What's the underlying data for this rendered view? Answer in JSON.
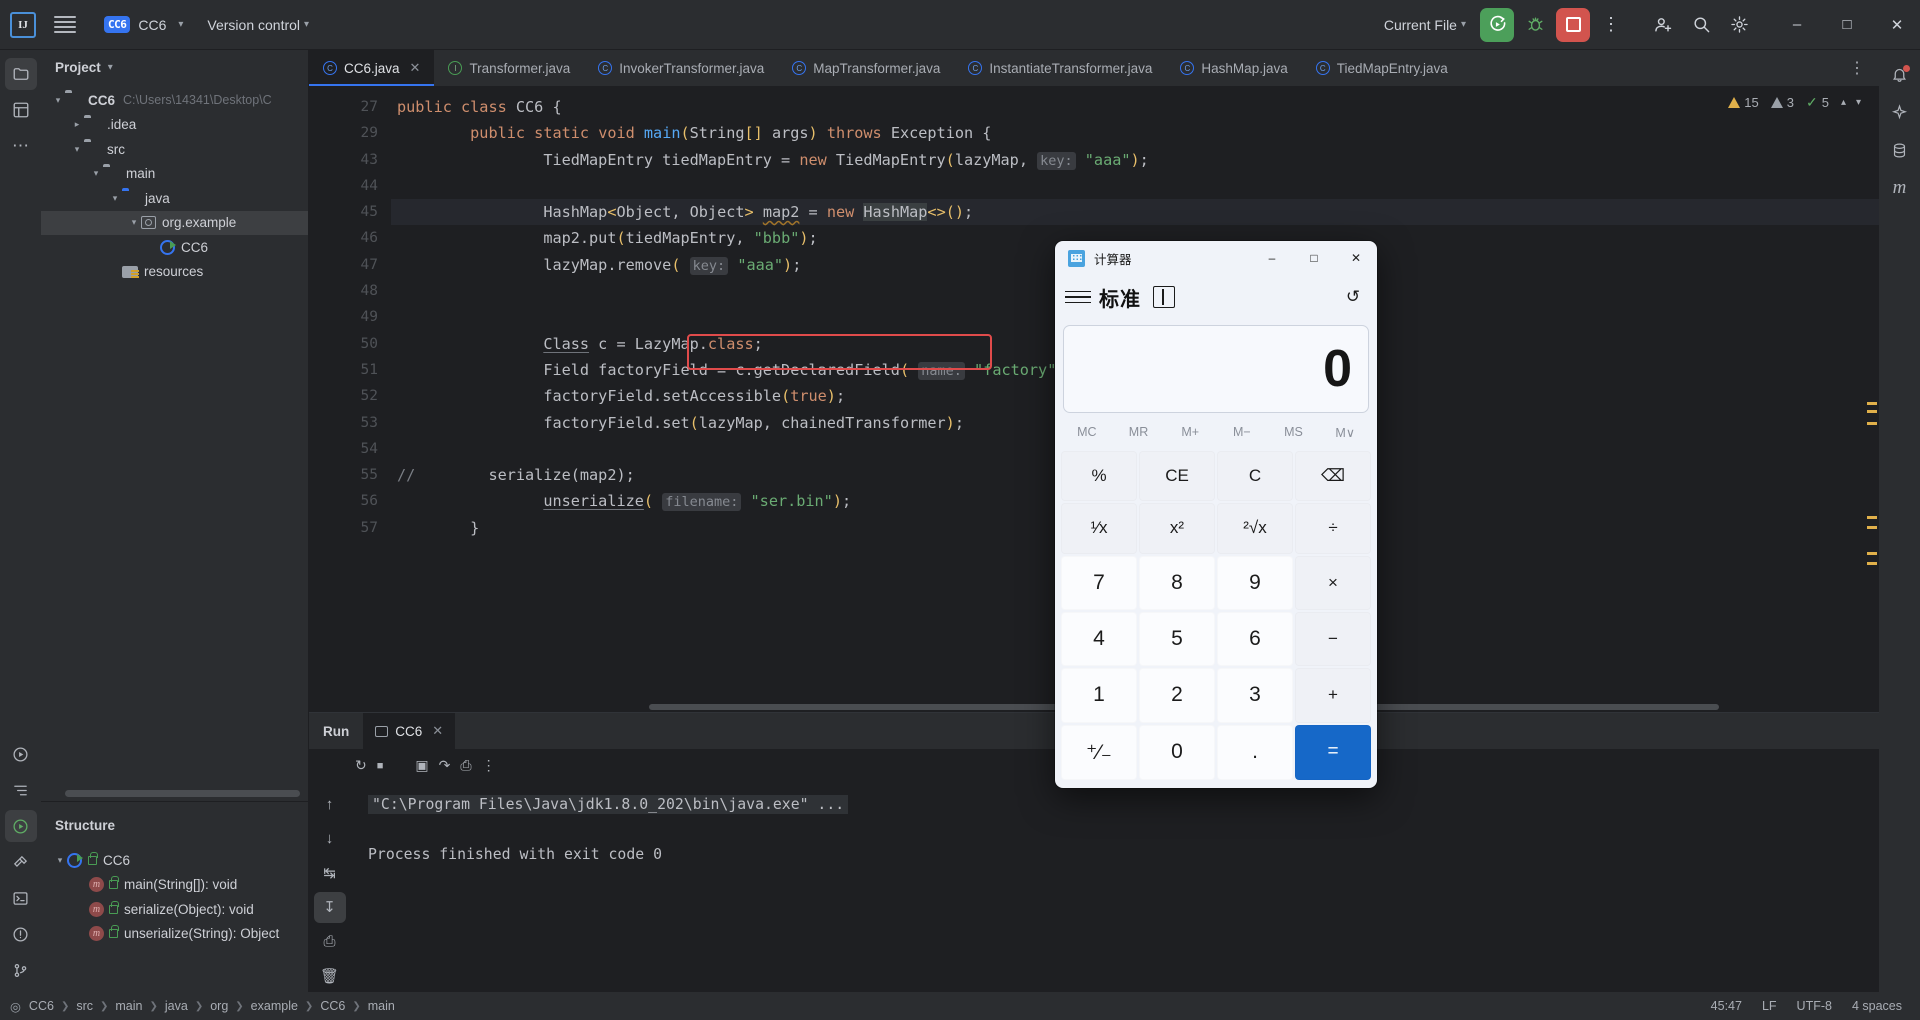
{
  "titlebar": {
    "logo": "IJ",
    "project_badge": "CC6",
    "project_name": "CC6",
    "version_control": "Version control",
    "run_config": "Current File",
    "icons": {
      "hamburger": "hamburger-icon",
      "run": "run-icon",
      "debug": "debug-icon",
      "stop": "stop-icon",
      "more": "more-vertical-icon",
      "account": "account-icon",
      "search": "search-icon",
      "settings": "gear-icon",
      "minimize": "–",
      "maximize": "□",
      "close": "✕"
    }
  },
  "project_panel": {
    "title": "Project",
    "items": [
      {
        "label": "CC6",
        "path": "C:\\Users\\14341\\Desktop\\C",
        "icon": "folder-module-icon",
        "arrow": "open",
        "depth": 0,
        "bold": true
      },
      {
        "label": ".idea",
        "icon": "folder-icon",
        "arrow": "closed",
        "depth": 1
      },
      {
        "label": "src",
        "icon": "folder-icon",
        "arrow": "open",
        "depth": 1
      },
      {
        "label": "main",
        "icon": "folder-icon",
        "arrow": "open",
        "depth": 2
      },
      {
        "label": "java",
        "icon": "folder-source-icon",
        "arrow": "open",
        "depth": 3
      },
      {
        "label": "org.example",
        "icon": "package-icon",
        "arrow": "open",
        "depth": 4,
        "selected": true
      },
      {
        "label": "CC6",
        "icon": "java-class-runnable-icon",
        "arrow": "none",
        "depth": 5
      },
      {
        "label": "resources",
        "icon": "folder-resources-icon",
        "arrow": "none",
        "depth": 3
      }
    ]
  },
  "structure_panel": {
    "title": "Structure",
    "items": [
      {
        "label": "CC6",
        "icon": "java-class-runnable-icon",
        "modifier": "public-lock-icon",
        "arrow": "open",
        "depth": 0
      },
      {
        "label": "main(String[]): void",
        "icon": "method-icon",
        "modifier": "public-lock-icon",
        "arrow": "none",
        "depth": 1
      },
      {
        "label": "serialize(Object): void",
        "icon": "method-icon",
        "modifier": "public-lock-icon",
        "arrow": "none",
        "depth": 1
      },
      {
        "label": "unserialize(String): Object",
        "icon": "method-icon",
        "modifier": "public-lock-icon",
        "arrow": "none",
        "depth": 1
      }
    ]
  },
  "editor_tabs": [
    {
      "label": "CC6.java",
      "icon": "java-class-runnable-icon",
      "active": true,
      "closable": true
    },
    {
      "label": "Transformer.java",
      "icon": "java-interface-icon",
      "active": false
    },
    {
      "label": "InvokerTransformer.java",
      "icon": "java-class-icon",
      "active": false
    },
    {
      "label": "MapTransformer.java",
      "icon": "java-class-icon",
      "active": false
    },
    {
      "label": "InstantiateTransformer.java",
      "icon": "java-class-icon",
      "active": false
    },
    {
      "label": "HashMap.java",
      "icon": "java-class-icon",
      "active": false
    },
    {
      "label": "TiedMapEntry.java",
      "icon": "java-class-icon",
      "active": false
    }
  ],
  "inspections": {
    "warnings": "15",
    "weak_warnings": "3",
    "passed": "5"
  },
  "code_lines": [
    {
      "num": "27",
      "indent": 0,
      "segments": [
        {
          "t": "public ",
          "c": "kw"
        },
        {
          "t": "class ",
          "c": "kw"
        },
        {
          "t": "CC6 ",
          "c": "typ"
        },
        {
          "t": "{",
          "c": "typ"
        }
      ]
    },
    {
      "num": "29",
      "indent": 1,
      "segments": [
        {
          "t": "public ",
          "c": "kw"
        },
        {
          "t": "static ",
          "c": "kw"
        },
        {
          "t": "void ",
          "c": "kw"
        },
        {
          "t": "main",
          "c": "fn"
        },
        {
          "t": "(",
          "c": "angle"
        },
        {
          "t": "String",
          "c": "typ"
        },
        {
          "t": "[] ",
          "c": "angle"
        },
        {
          "t": "args",
          "c": "typ"
        },
        {
          "t": ")",
          "c": "angle"
        },
        {
          "t": " ",
          "c": "typ"
        },
        {
          "t": "throws ",
          "c": "kw"
        },
        {
          "t": "Exception {",
          "c": "typ"
        }
      ]
    },
    {
      "num": "43",
      "indent": 2,
      "segments": [
        {
          "t": "TiedMapEntry tiedMapEntry = ",
          "c": "typ"
        },
        {
          "t": "new ",
          "c": "kw"
        },
        {
          "t": "TiedMapEntry",
          "c": "typ"
        },
        {
          "t": "(",
          "c": "angle"
        },
        {
          "t": "lazyMap, ",
          "c": "typ"
        },
        {
          "t": "key:",
          "c": "hint"
        },
        {
          "t": " ",
          "c": "typ"
        },
        {
          "t": "\"aaa\"",
          "c": "str"
        },
        {
          "t": ")",
          "c": "angle"
        },
        {
          "t": ";",
          "c": "typ"
        }
      ]
    },
    {
      "num": "44",
      "indent": 0,
      "segments": []
    },
    {
      "num": "45",
      "indent": 2,
      "highlight": true,
      "segments": [
        {
          "t": "HashMap",
          "c": "typ"
        },
        {
          "t": "<",
          "c": "angle"
        },
        {
          "t": "Object, Object",
          "c": "typ"
        },
        {
          "t": ">",
          "c": "angle"
        },
        {
          "t": " ",
          "c": "typ"
        },
        {
          "t": "map2",
          "c": "wavy"
        },
        {
          "t": " = ",
          "c": "typ"
        },
        {
          "t": "new ",
          "c": "kw"
        },
        {
          "t": "HashMap",
          "c": "hgl"
        },
        {
          "t": "<>()",
          "c": "angle"
        },
        {
          "t": ";",
          "c": "typ"
        }
      ]
    },
    {
      "num": "46",
      "indent": 2,
      "segments": [
        {
          "t": "map2.",
          "c": "typ"
        },
        {
          "t": "put",
          "c": "typ"
        },
        {
          "t": "(",
          "c": "angle"
        },
        {
          "t": "tiedMapEntry, ",
          "c": "typ"
        },
        {
          "t": "\"bbb\"",
          "c": "str"
        },
        {
          "t": ")",
          "c": "angle"
        },
        {
          "t": ";",
          "c": "typ"
        }
      ]
    },
    {
      "num": "47",
      "indent": 2,
      "boxed": true,
      "segments": [
        {
          "t": "lazyMap.",
          "c": "typ"
        },
        {
          "t": "remove",
          "c": "typ"
        },
        {
          "t": "(",
          "c": "angle"
        },
        {
          "t": " ",
          "c": "typ"
        },
        {
          "t": "key:",
          "c": "hint"
        },
        {
          "t": " ",
          "c": "typ"
        },
        {
          "t": "\"aaa\"",
          "c": "str"
        },
        {
          "t": ")",
          "c": "angle"
        },
        {
          "t": ";",
          "c": "typ"
        }
      ]
    },
    {
      "num": "48",
      "indent": 0,
      "segments": []
    },
    {
      "num": "49",
      "indent": 0,
      "segments": []
    },
    {
      "num": "50",
      "indent": 2,
      "segments": [
        {
          "t": "Class",
          "c": "undl"
        },
        {
          "t": " c = LazyMap.",
          "c": "typ"
        },
        {
          "t": "class",
          "c": "kw"
        },
        {
          "t": ";",
          "c": "typ"
        }
      ]
    },
    {
      "num": "51",
      "indent": 2,
      "segments": [
        {
          "t": "Field factoryField = c.",
          "c": "typ"
        },
        {
          "t": "getDeclaredField",
          "c": "typ"
        },
        {
          "t": "(",
          "c": "angle"
        },
        {
          "t": " ",
          "c": "typ"
        },
        {
          "t": "name:",
          "c": "hint"
        },
        {
          "t": " ",
          "c": "typ"
        },
        {
          "t": "\"factory\"",
          "c": "str"
        },
        {
          "t": ")",
          "c": "angle"
        },
        {
          "t": ";",
          "c": "typ"
        }
      ]
    },
    {
      "num": "52",
      "indent": 2,
      "segments": [
        {
          "t": "factoryField.",
          "c": "typ"
        },
        {
          "t": "setAccessible",
          "c": "typ"
        },
        {
          "t": "(",
          "c": "angle"
        },
        {
          "t": "true",
          "c": "kw"
        },
        {
          "t": ")",
          "c": "angle"
        },
        {
          "t": ";",
          "c": "typ"
        }
      ]
    },
    {
      "num": "53",
      "indent": 2,
      "segments": [
        {
          "t": "factoryField.",
          "c": "typ"
        },
        {
          "t": "set",
          "c": "typ"
        },
        {
          "t": "(",
          "c": "angle"
        },
        {
          "t": "lazyMap, chainedTransformer",
          "c": "typ"
        },
        {
          "t": ")",
          "c": "angle"
        },
        {
          "t": ";",
          "c": "typ"
        }
      ]
    },
    {
      "num": "54",
      "indent": 0,
      "segments": []
    },
    {
      "num": "55",
      "indent": 0,
      "comment_prefix": "//",
      "segments": [
        {
          "t": "        serialize(map2);",
          "c": "typ"
        }
      ]
    },
    {
      "num": "56",
      "indent": 2,
      "segments": [
        {
          "t": "unserialize",
          "c": "undl"
        },
        {
          "t": "(",
          "c": "angle"
        },
        {
          "t": " ",
          "c": "typ"
        },
        {
          "t": "filename:",
          "c": "hint"
        },
        {
          "t": " ",
          "c": "typ"
        },
        {
          "t": "\"ser.bin\"",
          "c": "str"
        },
        {
          "t": ")",
          "c": "angle"
        },
        {
          "t": ";",
          "c": "typ"
        }
      ]
    },
    {
      "num": "57",
      "indent": 1,
      "segments": [
        {
          "t": "}",
          "c": "typ"
        }
      ]
    }
  ],
  "run_panel": {
    "title": "Run",
    "tab_label": "CC6",
    "console": {
      "command": "\"C:\\Program Files\\Java\\jdk1.8.0_202\\bin\\java.exe\" ...",
      "output": "Process finished with exit code 0"
    }
  },
  "status_bar": {
    "breadcrumbs": [
      "CC6",
      "src",
      "main",
      "java",
      "org",
      "example",
      "CC6",
      "main"
    ],
    "position": "45:47",
    "line_ending": "LF",
    "encoding": "UTF-8",
    "indent": "4 spaces"
  },
  "calculator": {
    "window_title": "计算器",
    "mode": "标准",
    "display_value": "0",
    "memory_buttons": [
      "MC",
      "MR",
      "M+",
      "M−",
      "MS",
      "M∨"
    ],
    "keys": [
      {
        "label": "%",
        "type": "fn2"
      },
      {
        "label": "CE",
        "type": "fn2"
      },
      {
        "label": "C",
        "type": "fn2"
      },
      {
        "label": "⌫",
        "type": "fn2"
      },
      {
        "label": "¹⁄x",
        "type": "fn2"
      },
      {
        "label": "x²",
        "type": "fn2"
      },
      {
        "label": "²√x",
        "type": "fn2"
      },
      {
        "label": "÷",
        "type": "fn2"
      },
      {
        "label": "7",
        "type": "num"
      },
      {
        "label": "8",
        "type": "num"
      },
      {
        "label": "9",
        "type": "num"
      },
      {
        "label": "×",
        "type": "fn2"
      },
      {
        "label": "4",
        "type": "num"
      },
      {
        "label": "5",
        "type": "num"
      },
      {
        "label": "6",
        "type": "num"
      },
      {
        "label": "−",
        "type": "fn2"
      },
      {
        "label": "1",
        "type": "num"
      },
      {
        "label": "2",
        "type": "num"
      },
      {
        "label": "3",
        "type": "num"
      },
      {
        "label": "+",
        "type": "fn2"
      },
      {
        "label": "⁺⁄₋",
        "type": "num"
      },
      {
        "label": "0",
        "type": "num"
      },
      {
        "label": ".",
        "type": "num"
      },
      {
        "label": "=",
        "type": "eq"
      }
    ],
    "titlebar_buttons": {
      "minimize": "–",
      "maximize": "□",
      "close": "✕"
    },
    "accent_color": "#1668c8"
  }
}
